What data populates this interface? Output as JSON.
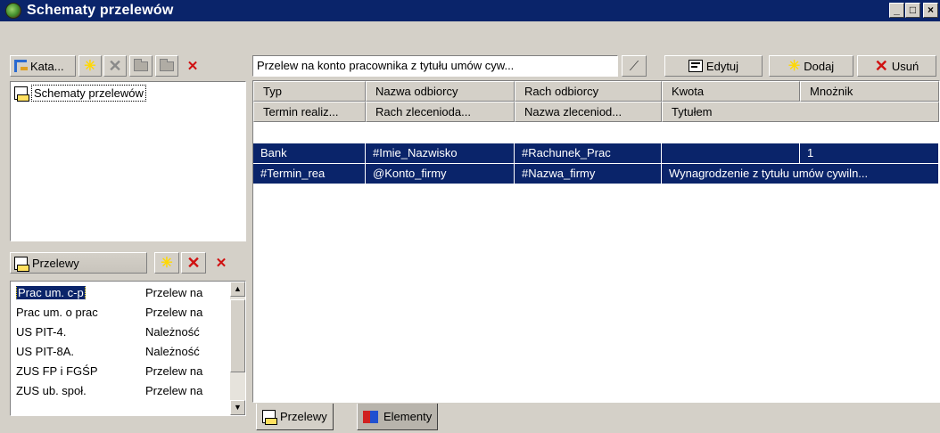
{
  "window": {
    "title": "Schematy przelewów",
    "controls": {
      "minimize": "_",
      "maximize": "□",
      "close": "×"
    }
  },
  "left_toolbar": {
    "katalog_label": "Kata..."
  },
  "tree": {
    "root_label": "Schematy przelewów"
  },
  "przelewy_panel": {
    "label": "Przelewy",
    "rows": [
      {
        "name": "Prac um. c-p",
        "desc": "Przelew na"
      },
      {
        "name": "Prac um. o prac",
        "desc": "Przelew na"
      },
      {
        "name": "US PIT-4.",
        "desc": "Należność"
      },
      {
        "name": "US PIT-8A.",
        "desc": "Należność"
      },
      {
        "name": "ZUS FP i FGŚP",
        "desc": "Przelew na"
      },
      {
        "name": "ZUS ub. społ.",
        "desc": "Przelew na"
      }
    ],
    "selected_index": 0
  },
  "main_toolbar": {
    "combo_value": "Przelew na konto pracownika z tytułu umów cyw...",
    "edit_label": "Edytuj",
    "add_label": "Dodaj",
    "delete_label": "Usuń"
  },
  "grid": {
    "header_row1": [
      "Typ",
      "Nazwa odbiorcy",
      "Rach odbiorcy",
      "Kwota",
      "Mnożnik"
    ],
    "header_row2": [
      "Termin realiz...",
      "Rach zlecenioda...",
      "Nazwa zleceniod...",
      "Tytułem"
    ],
    "row1": [
      "Bank",
      "#Imie_Nazwisko",
      "#Rachunek_Prac",
      "",
      "1"
    ],
    "row2": [
      "#Termin_rea",
      "@Konto_firmy",
      "#Nazwa_firmy",
      "Wynagrodzenie z tytułu umów cywiln..."
    ]
  },
  "tabs": {
    "przelewy": "Przelewy",
    "elementy": "Elementy"
  },
  "colors": {
    "selection": "#0a246a",
    "face": "#d4d0c8",
    "title_bar": "#0a246a"
  }
}
